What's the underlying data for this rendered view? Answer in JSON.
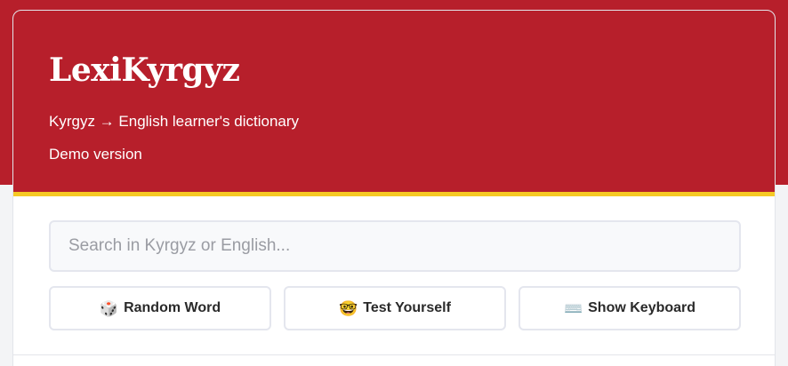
{
  "header": {
    "brand": "LexiKyrgyz",
    "subtitle": "Kyrgyz → English learner's dictionary",
    "version": "Demo version"
  },
  "search": {
    "placeholder": "Search in Kyrgyz or English...",
    "value": ""
  },
  "actions": [
    {
      "icon": "🎲",
      "icon_name": "dice-icon",
      "label": "Random Word"
    },
    {
      "icon": "🤓",
      "icon_name": "nerd-face-icon",
      "label": "Test Yourself"
    },
    {
      "icon": "⌨️",
      "icon_name": "keyboard-icon",
      "label": "Show Keyboard"
    }
  ],
  "colors": {
    "brand_red": "#b71f2b",
    "accent_yellow": "#f6c924"
  }
}
